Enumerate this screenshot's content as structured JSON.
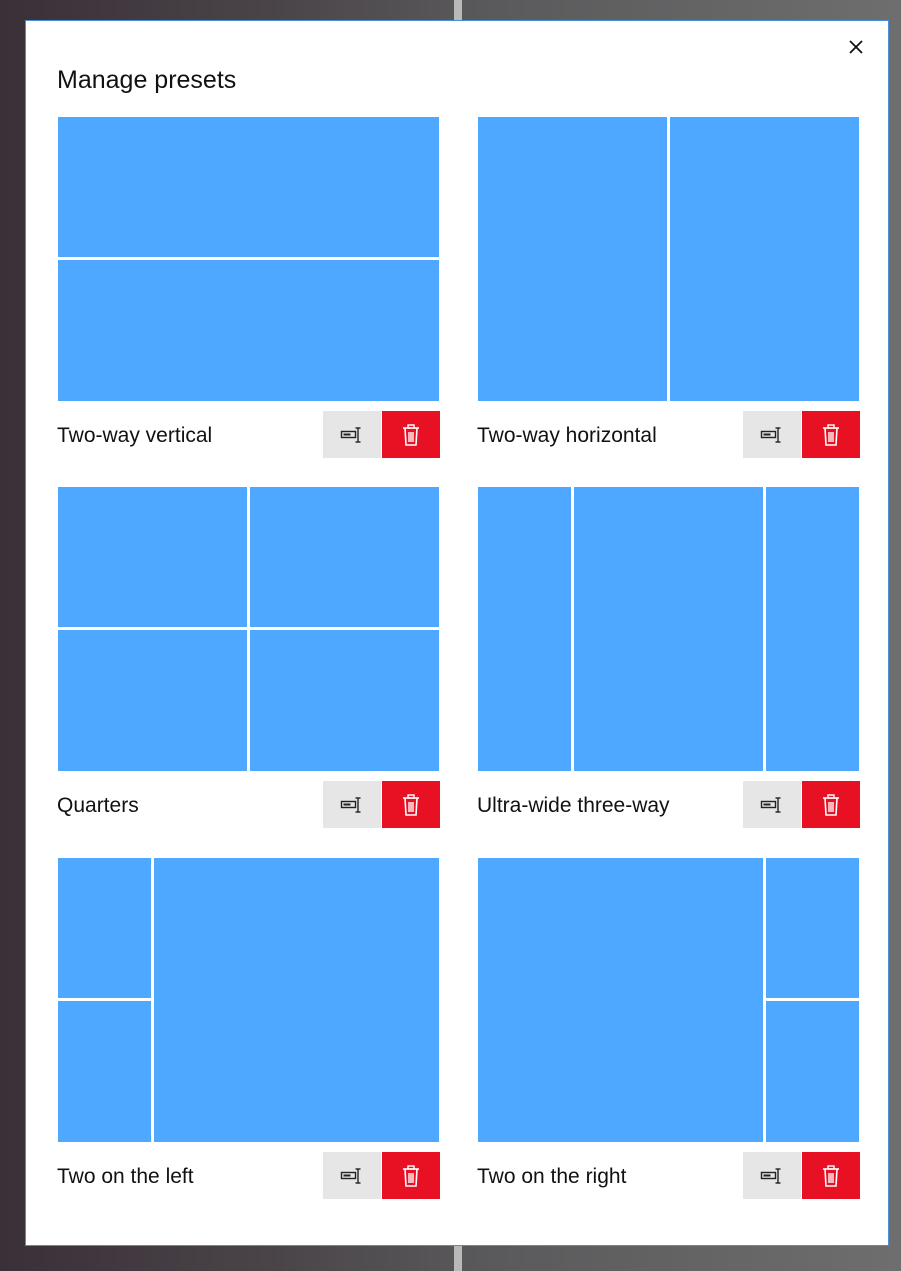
{
  "dialog": {
    "title": "Manage presets",
    "close_icon": "close-icon"
  },
  "colors": {
    "zone": "#4fa8ff",
    "rename_bg": "#e6e6e6",
    "delete_bg": "#e81123"
  },
  "presets": [
    {
      "label": "Two-way vertical"
    },
    {
      "label": "Two-way horizontal"
    },
    {
      "label": "Quarters"
    },
    {
      "label": "Ultra-wide three-way"
    },
    {
      "label": "Two on the left"
    },
    {
      "label": "Two on the right"
    }
  ],
  "actions": {
    "rename_icon": "rename-icon",
    "delete_icon": "trash-icon"
  }
}
